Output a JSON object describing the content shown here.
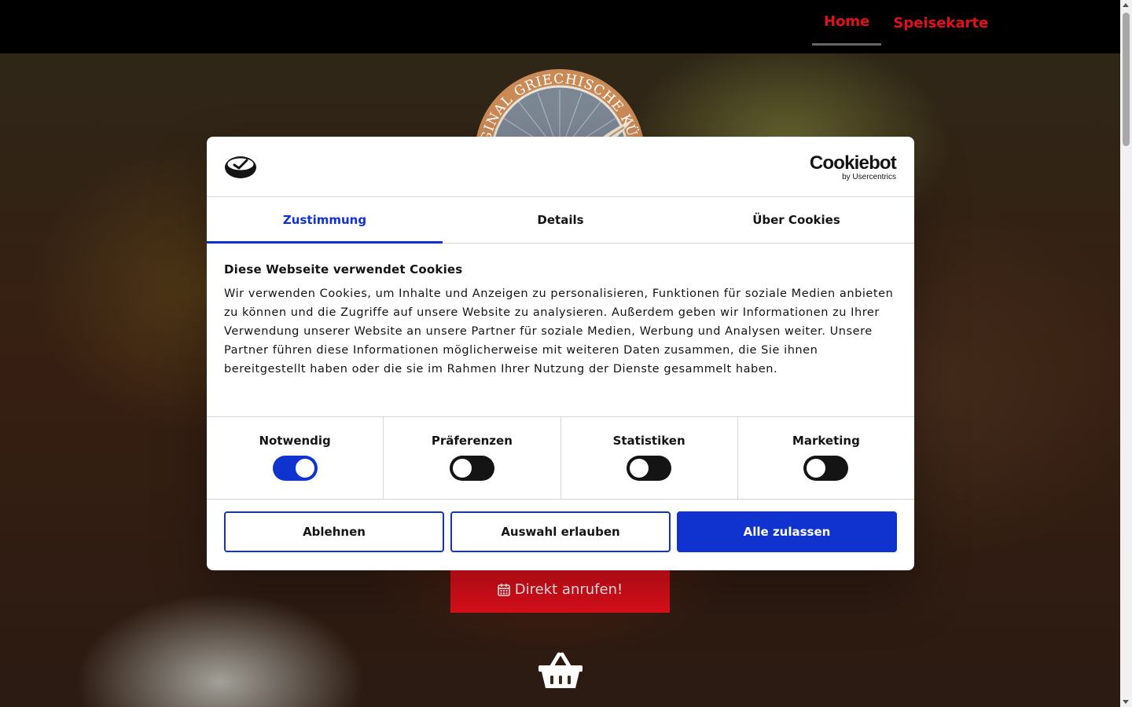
{
  "nav": {
    "items": [
      {
        "label": "Home",
        "active": true
      },
      {
        "label": "Speisekarte",
        "active": false
      }
    ],
    "color": "#e3101c"
  },
  "hero": {
    "logo_text": "ORIGINAL GRIECHISCHE KÜCHE",
    "call_button": "Direkt anrufen!",
    "call_icon": "calendar-icon",
    "basket_icon": "shopping-basket-icon"
  },
  "cookie_dialog": {
    "brand": {
      "name": "Cookiebot",
      "by": "by Usercentrics"
    },
    "tabs": [
      {
        "label": "Zustimmung",
        "active": true
      },
      {
        "label": "Details",
        "active": false
      },
      {
        "label": "Über Cookies",
        "active": false
      }
    ],
    "title": "Diese Webseite verwendet Cookies",
    "text": "Wir verwenden Cookies, um Inhalte und Anzeigen zu personalisieren, Funktionen für soziale Medien anbieten zu können und die Zugriffe auf unsere Website zu analysieren. Außerdem geben wir Informationen zu Ihrer Verwendung unserer Website an unsere Partner für soziale Medien, Werbung und Analysen weiter. Unsere Partner führen diese Informationen möglicherweise mit weiteren Daten zusammen, die Sie ihnen bereitgestellt haben oder die sie im Rahmen Ihrer Nutzung der Dienste gesammelt haben.",
    "toggles": [
      {
        "label": "Notwendig",
        "on": true
      },
      {
        "label": "Präferenzen",
        "on": false
      },
      {
        "label": "Statistiken",
        "on": false
      },
      {
        "label": "Marketing",
        "on": false
      }
    ],
    "buttons": {
      "decline": "Ablehnen",
      "allow_selection": "Auswahl erlauben",
      "allow_all": "Alle zulassen"
    },
    "accent_color": "#1032cf"
  }
}
